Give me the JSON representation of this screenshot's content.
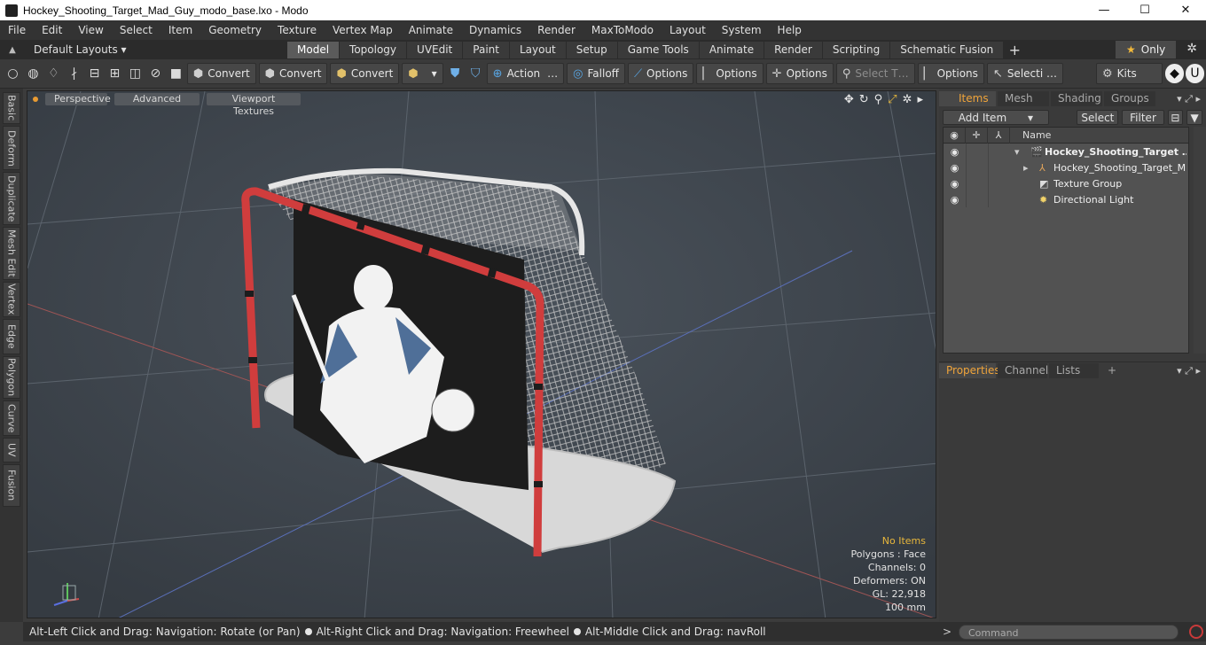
{
  "window": {
    "title": "Hockey_Shooting_Target_Mad_Guy_modo_base.lxo - Modo",
    "minimize": "—",
    "maximize": "☐",
    "close": "✕"
  },
  "menu": [
    "File",
    "Edit",
    "View",
    "Select",
    "Item",
    "Geometry",
    "Texture",
    "Vertex Map",
    "Animate",
    "Dynamics",
    "Render",
    "MaxToModo",
    "Layout",
    "System",
    "Help"
  ],
  "layouts": {
    "label": "Default Layouts ▾",
    "tabs": [
      "Model",
      "Topology",
      "UVEdit",
      "Paint",
      "Layout",
      "Setup",
      "Game Tools",
      "Animate",
      "Render",
      "Scripting",
      "Schematic Fusion"
    ],
    "active_tab": "Model",
    "only_label": "Only"
  },
  "toolbar": {
    "convert1": "Convert",
    "convert2": "Convert",
    "convert3": "Convert",
    "action": "Action",
    "action_more": "…",
    "falloff": "Falloff",
    "options1": "Options",
    "options2": "Options",
    "options3": "Options",
    "select_t": "Select T…",
    "options4": "Options",
    "selecti": "Selecti …",
    "kits": "Kits"
  },
  "left_tabs": [
    "Basic",
    "Deform",
    "Duplicate",
    "Mesh Edit",
    "Vertex",
    "Edge",
    "Polygon",
    "Curve",
    "UV",
    "Fusion"
  ],
  "viewport": {
    "perspective": "Perspective",
    "advanced": "Advanced",
    "textures": "Viewport Textures",
    "info": {
      "no_items": "No Items",
      "polygons": "Polygons : Face",
      "channels": "Channels: 0",
      "deformers": "Deformers: ON",
      "gl": "GL: 22,918",
      "scale": "100 mm"
    }
  },
  "items_panel": {
    "tabs": [
      "Items",
      "Mesh …",
      "Shading",
      "Groups"
    ],
    "add_item": "Add Item",
    "select": "Select",
    "filter": "Filter",
    "name_header": "Name",
    "rows": [
      "Hockey_Shooting_Target …",
      "Hockey_Shooting_Target_M …",
      "Texture Group",
      "Directional Light"
    ]
  },
  "properties_panel": {
    "tabs": [
      "Properties",
      "Channels",
      "Lists"
    ],
    "plus": "+"
  },
  "status": {
    "hint1": "Alt-Left Click and Drag: Navigation: Rotate (or Pan)",
    "hint2": "Alt-Right Click and Drag: Navigation: Freewheel",
    "hint3": "Alt-Middle Click and Drag: navRoll"
  },
  "command": {
    "prompt": ">",
    "placeholder": "Command"
  }
}
